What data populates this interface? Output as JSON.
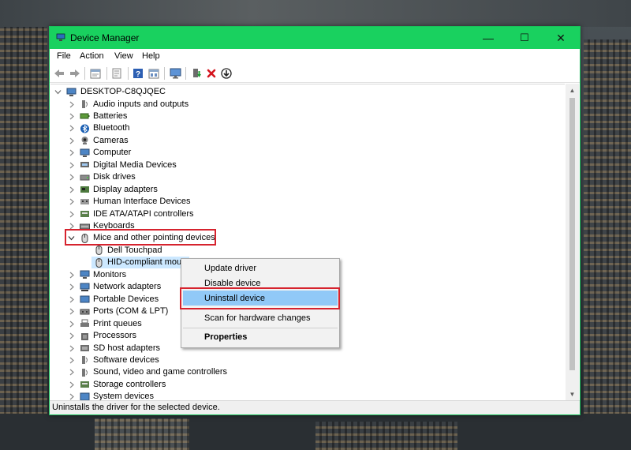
{
  "window": {
    "title": "Device Manager",
    "buttons": {
      "minimize": "—",
      "maximize": "☐",
      "close": "✕"
    }
  },
  "menu": [
    "File",
    "Action",
    "View",
    "Help"
  ],
  "toolbar": [
    "back-icon",
    "forward-icon",
    "properties-icon",
    "update-icon",
    "help-icon",
    "view-icon",
    "monitor-icon",
    "enable-device-icon",
    "uninstall-x-icon",
    "download-driver-icon"
  ],
  "tree": {
    "root": "DESKTOP-C8QJQEC",
    "categories": [
      "Audio inputs and outputs",
      "Batteries",
      "Bluetooth",
      "Cameras",
      "Computer",
      "Digital Media Devices",
      "Disk drives",
      "Display adapters",
      "Human Interface Devices",
      "IDE ATA/ATAPI controllers",
      "Keyboards",
      "Mice and other pointing devices",
      "Monitors",
      "Network adapters",
      "Portable Devices",
      "Ports (COM & LPT)",
      "Print queues",
      "Processors",
      "SD host adapters",
      "Software devices",
      "Sound, video and game controllers",
      "Storage controllers",
      "System devices"
    ],
    "mice_children": [
      "Dell Touchpad",
      "HID-compliant mous"
    ]
  },
  "context_menu": {
    "items": [
      "Update driver",
      "Disable device",
      "Uninstall device",
      "Scan for hardware changes",
      "Properties"
    ],
    "selected": "Uninstall device"
  },
  "status": "Uninstalls the driver for the selected device.",
  "colors": {
    "titlebar": "#19d15f",
    "highlight_box": "#d6232e",
    "menu_selection": "#91c9f7"
  }
}
